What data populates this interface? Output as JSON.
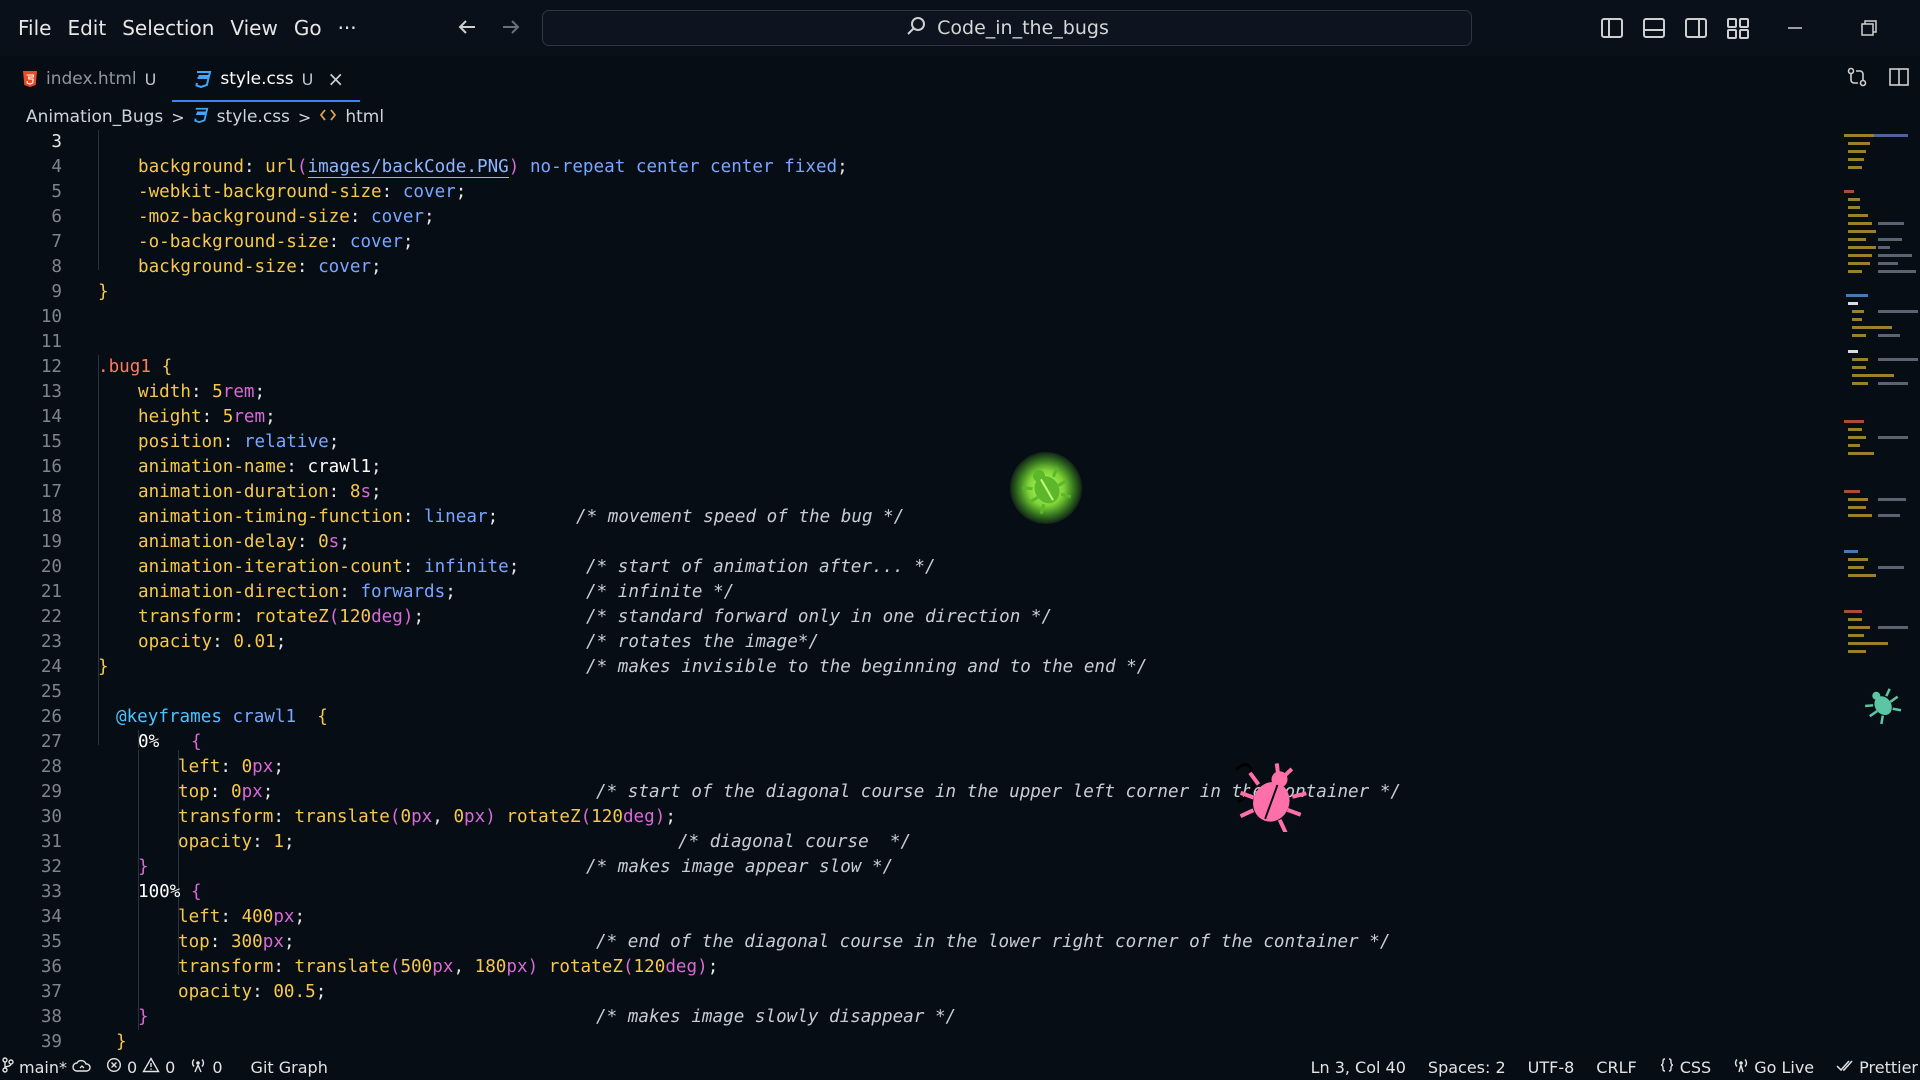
{
  "menu": {
    "items": [
      "File",
      "Edit",
      "Selection",
      "View",
      "Go"
    ],
    "more": "···"
  },
  "search": {
    "text": "Code_in_the_bugs"
  },
  "tabs": [
    {
      "name": "index.html",
      "status": "U",
      "icon": "html5-icon",
      "active": false
    },
    {
      "name": "style.css",
      "status": "U",
      "icon": "css-icon",
      "active": true,
      "close": "×"
    }
  ],
  "breadcrumb": {
    "folder": "Animation_Bugs",
    "file": "style.css",
    "symbol": "html",
    "sep": ">"
  },
  "editor": {
    "current_line": "3",
    "line_numbers": [
      "3",
      "4",
      "5",
      "6",
      "7",
      "8",
      "9",
      "10",
      "11",
      "12",
      "13",
      "14",
      "15",
      "16",
      "17",
      "18",
      "19",
      "20",
      "21",
      "22",
      "23",
      "24",
      "25",
      "26",
      "27",
      "28",
      "29",
      "30",
      "31",
      "32",
      "33",
      "34",
      "35",
      "36",
      "37",
      "38",
      "39"
    ],
    "lines": {
      "l3": {
        "a": "background",
        "b": ": ",
        "c": "url",
        "d": "(",
        "e": "images/backCode.PNG",
        "f": ")",
        "g": " no-repeat center center fixed",
        "h": ";"
      },
      "l4": {
        "a": "-webkit-background-size",
        "b": ": ",
        "c": "cover",
        "d": ";"
      },
      "l5": {
        "a": "-moz-background-size",
        "b": ": ",
        "c": "cover",
        "d": ";"
      },
      "l6": {
        "a": "-o-background-size",
        "b": ": ",
        "c": "cover",
        "d": ";"
      },
      "l7": {
        "a": "background-size",
        "b": ": ",
        "c": "cover",
        "d": ";"
      },
      "l8": {
        "a": "}"
      },
      "l11": {
        "a": ".bug1",
        "b": " ",
        "c": "{"
      },
      "l12": {
        "a": "width",
        "b": ": ",
        "c": "5",
        "d": "rem",
        "e": ";"
      },
      "l13": {
        "a": "height",
        "b": ": ",
        "c": "5",
        "d": "rem",
        "e": ";"
      },
      "l14": {
        "a": "position",
        "b": ": ",
        "c": "relative",
        "d": ";"
      },
      "l15": {
        "a": "animation-name",
        "b": ": ",
        "c": "crawl1",
        "d": ";"
      },
      "l16": {
        "a": "animation-duration",
        "b": ": ",
        "c": "8",
        "d": "s",
        "e": ";",
        "comment": "/* movement speed of the bug */"
      },
      "l17": {
        "a": "animation-timing-function",
        "b": ": ",
        "c": "linear",
        "d": ";"
      },
      "l18": {
        "a": "animation-delay",
        "b": ": ",
        "c": "0",
        "d": "s",
        "e": ";",
        "comment": "/* start of animation after... */"
      },
      "l19": {
        "a": "animation-iteration-count",
        "b": ": ",
        "c": "infinite",
        "d": ";",
        "comment": "/* infinite */"
      },
      "l20": {
        "a": "animation-direction",
        "b": ": ",
        "c": "forwards",
        "d": ";",
        "comment": "/* standard forward only in one direction */"
      },
      "l21": {
        "a": "transform",
        "b": ": ",
        "c": "rotateZ",
        "d": "(",
        "e": "120",
        "f": "deg",
        "g": ")",
        "h": ";",
        "comment": "/* rotates the image*/"
      },
      "l22": {
        "a": "opacity",
        "b": ": ",
        "c": "0.01",
        "d": ";",
        "comment": "/* makes invisible to the beginning and to the end */"
      },
      "l23": {
        "a": "}"
      },
      "l25": {
        "a": "@keyframes",
        "b": " crawl1",
        "c": "  {"
      },
      "l26": {
        "a": "0%",
        "b": "   {"
      },
      "l27": {
        "a": "left",
        "b": ": ",
        "c": "0",
        "d": "px",
        "e": ";",
        "comment": "/* start of the diagonal course in the upper left corner in the container */"
      },
      "l28": {
        "a": "top",
        "b": ": ",
        "c": "0",
        "d": "px",
        "e": ";"
      },
      "l29": {
        "a": "transform",
        "b": ": ",
        "c": "translate",
        "d": "(",
        "e": "0",
        "f": "px",
        "g": ", ",
        "h": "0",
        "i": "px",
        "j": ")",
        "k": " rotateZ",
        "l": "(",
        "m": "120",
        "n": "deg",
        "o": ")",
        "p": ";",
        "comment": "/* diagonal course  */"
      },
      "l30": {
        "a": "opacity",
        "b": ": ",
        "c": "1",
        "d": ";",
        "comment": "/* makes image appear slow */"
      },
      "l31": {
        "a": "}"
      },
      "l32": {
        "a": "100%",
        "b": " {"
      },
      "l33": {
        "a": "left",
        "b": ": ",
        "c": "400",
        "d": "px",
        "e": ";",
        "comment": "/* end of the diagonal course in the lower right corner of the container */"
      },
      "l34": {
        "a": "top",
        "b": ": ",
        "c": "300",
        "d": "px",
        "e": ";"
      },
      "l35": {
        "a": "transform",
        "b": ": ",
        "c": "translate",
        "d": "(",
        "e": "500",
        "f": "px",
        "g": ", ",
        "h": "180",
        "i": "px",
        "j": ")",
        "k": " rotateZ",
        "l": "(",
        "m": "120",
        "n": "deg",
        "o": ")",
        "p": ";"
      },
      "l36": {
        "a": "opacity",
        "b": ": ",
        "c": "00.5",
        "d": ";",
        "comment": "/* makes image slowly disappear */"
      },
      "l37": {
        "a": "}"
      },
      "l38": {
        "a": "}"
      }
    }
  },
  "status": {
    "branch": "main*",
    "errors": "0",
    "warnings": "0",
    "ports": "0",
    "git_graph": "Git Graph",
    "position": "Ln 3, Col 40",
    "spaces": "Spaces: 2",
    "encoding": "UTF-8",
    "eol": "CRLF",
    "language": "CSS",
    "go_live": "Go Live",
    "prettier": "Prettier"
  },
  "colors": {
    "background": "#070d15",
    "accent": "#3b82f6",
    "property": "#f6c84c",
    "keyword": "#7aa6ff",
    "unit": "#d86ad6",
    "bug_green": "#7dd336",
    "bug_pink": "#ff6fa8"
  }
}
